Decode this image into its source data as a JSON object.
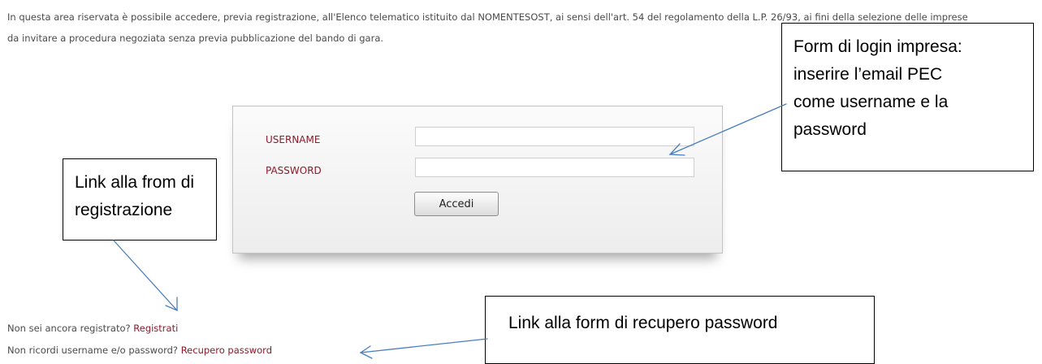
{
  "intro_text": "In questa area riservata è possibile accedere, previa registrazione, all'Elenco telematico istituito dal NOMENTESOST, ai sensi dell'art. 54 del regolamento della L.P. 26/93, ai fini della selezione delle imprese da invitare a procedura negoziata senza previa pubblicazione del bando di gara.",
  "login_form": {
    "username_label": "USERNAME",
    "password_label": "PASSWORD",
    "username_value": "",
    "password_value": "",
    "submit_label": "Accedi"
  },
  "links": {
    "register_prompt": "Non sei ancora registrato?",
    "register_link": "Registrati",
    "recover_prompt": "Non ricordi username e/o password?",
    "recover_link": "Recupero password"
  },
  "callouts": {
    "login": "Form di login impresa:\ninserire  l’email PEC\ncome username e la\npassword",
    "register": "Link alla from di\nregistrazione",
    "recover": "Link alla form di recupero password"
  },
  "colors": {
    "label_red": "#8c1a2a",
    "arrow_blue": "#4a7ebb"
  }
}
